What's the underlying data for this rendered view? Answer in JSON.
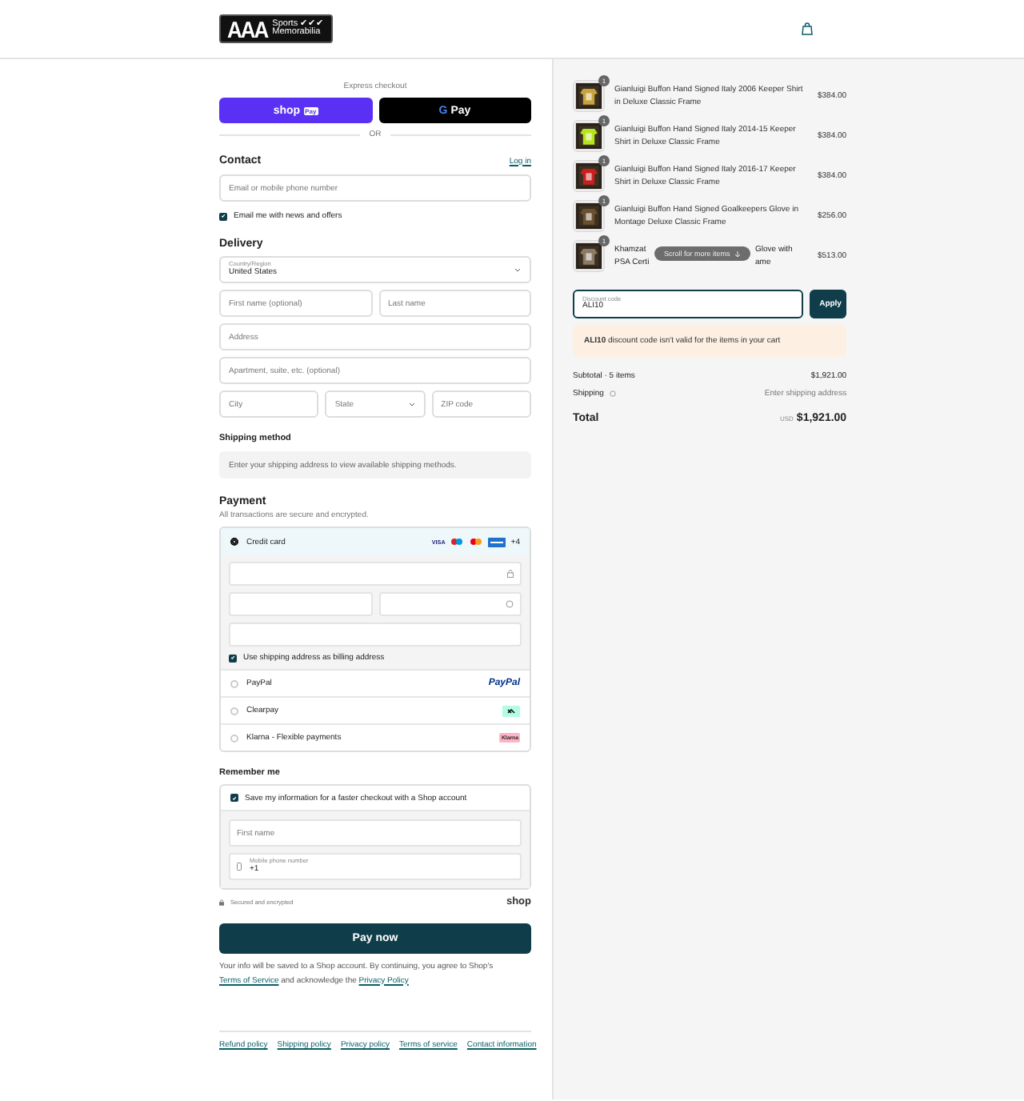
{
  "header": {
    "logo": {
      "mark": "AAA",
      "line1": "Sports ✔✔✔",
      "line2": "Memorabilia"
    }
  },
  "express": {
    "title": "Express checkout",
    "shop_pay": {
      "word": "shop",
      "tag": "Pay"
    },
    "google_pay": {
      "g": "G",
      "word": "Pay"
    },
    "divider": "OR"
  },
  "contact": {
    "title": "Contact",
    "login": "Log in",
    "email_placeholder": "Email or mobile phone number",
    "news": {
      "label": "Email me with news and offers",
      "checked": true
    }
  },
  "delivery": {
    "title": "Delivery",
    "country": {
      "label": "Country/Region",
      "value": "United States"
    },
    "first_name": "First name (optional)",
    "last_name": "Last name",
    "address": "Address",
    "apartment": "Apartment, suite, etc. (optional)",
    "city": "City",
    "state": "State",
    "zip": "ZIP code"
  },
  "shipping_method": {
    "title": "Shipping method",
    "message": "Enter your shipping address to view available shipping methods."
  },
  "payment": {
    "title": "Payment",
    "subtitle": "All transactions are secure and encrypted.",
    "methods": [
      {
        "kind": "card",
        "label": "Credit card",
        "selected": true,
        "brand_text": "VISA",
        "more": "+4"
      },
      {
        "kind": "paypal",
        "label": "PayPal",
        "selected": false,
        "logo": "PayPal"
      },
      {
        "kind": "clearpay",
        "label": "Clearpay",
        "selected": false
      },
      {
        "kind": "klarna",
        "label": "Klarna - Flexible payments",
        "selected": false,
        "logo": "Klarna"
      }
    ],
    "billing": {
      "label": "Use shipping address as billing address",
      "checked": true
    }
  },
  "remember": {
    "title": "Remember me",
    "save": {
      "label": "Save my information for a faster checkout with a Shop account",
      "checked": true
    },
    "first_name": "First name",
    "phone": {
      "label": "Mobile phone number",
      "value": "+1"
    },
    "secure": "Secured and encrypted",
    "shop_logo": "shop"
  },
  "pay_button": "Pay now",
  "legal": {
    "text": "Your info will be saved to a Shop account. By continuing, you agree to Shop's ",
    "terms": "Terms of Service",
    "middle": " and acknowledge the ",
    "privacy": "Privacy Policy"
  },
  "footer_links": [
    "Refund policy",
    "Shipping policy",
    "Privacy policy",
    "Terms of service",
    "Contact information"
  ],
  "cart": {
    "items": [
      {
        "title": "Gianluigi Buffon Hand Signed Italy 2006 Keeper Shirt in Deluxe Classic Frame",
        "price": "$384.00",
        "qty": "1"
      },
      {
        "title": "Gianluigi Buffon Hand Signed Italy 2014-15 Keeper Shirt in Deluxe Classic Frame",
        "price": "$384.00",
        "qty": "1"
      },
      {
        "title": "Gianluigi Buffon Hand Signed Italy 2016-17 Keeper Shirt in Deluxe Classic Frame",
        "price": "$384.00",
        "qty": "1"
      },
      {
        "title": "Gianluigi Buffon Hand Signed Goalkeepers Glove in Montage Deluxe Classic Frame",
        "price": "$256.00",
        "qty": "1"
      },
      {
        "title_parts": [
          "Khamzat",
          "Glove with",
          "PSA Certi",
          "ame"
        ],
        "price": "$513.00",
        "qty": "1"
      }
    ],
    "scroll_hint": "Scroll for more items",
    "discount": {
      "label": "Discount code",
      "value": "ALI10",
      "button": "Apply"
    },
    "error": {
      "code": "ALI10",
      "text": " discount code isn't valid for the items in your cart"
    },
    "subtotal": {
      "label": "Subtotal · 5 items",
      "value": "$1,921.00"
    },
    "shipping": {
      "label": "Shipping",
      "value": "Enter shipping address"
    },
    "total": {
      "label": "Total",
      "currency": "USD",
      "value": "$1,921.00"
    }
  }
}
